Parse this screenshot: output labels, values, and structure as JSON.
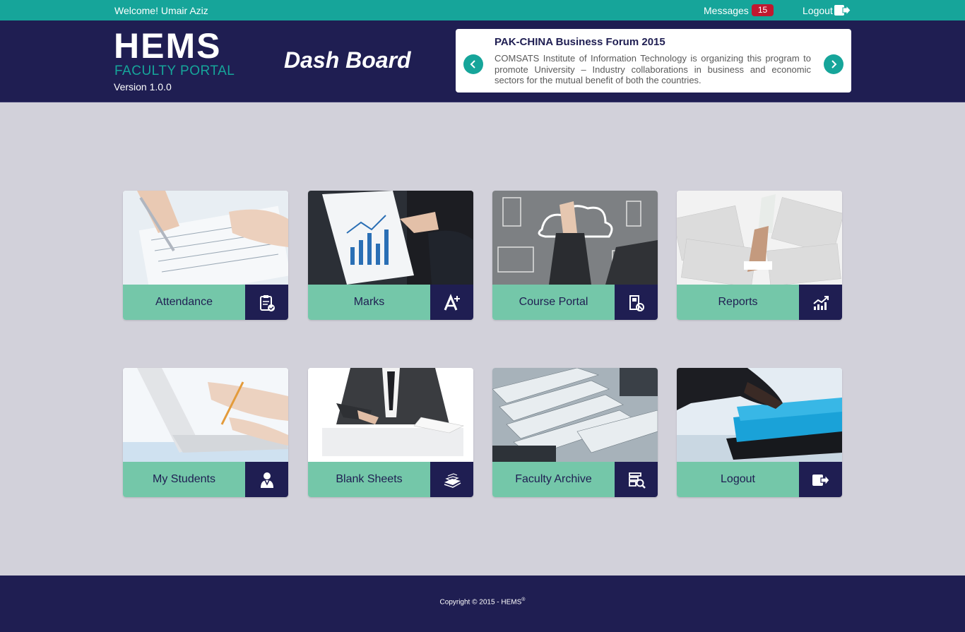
{
  "topbar": {
    "welcome": "Welcome! Umair Aziz",
    "messages_label": "Messages",
    "messages_count": "15",
    "logout_label": "Logout"
  },
  "header": {
    "logo_title": "HEMS",
    "logo_subtitle": "FACULTY PORTAL",
    "version": "Version 1.0.0",
    "page_title": "Dash Board"
  },
  "news": {
    "title": "PAK-CHINA Business Forum 2015",
    "body": "COMSATS Institute of Information Technology is organizing this program to promote University – Industry collaborations in business and economic sectors for the mutual benefit of both the countries."
  },
  "tiles": [
    {
      "label": "Attendance",
      "icon": "clipboard-check-icon"
    },
    {
      "label": "Marks",
      "icon": "grade-a-plus-icon"
    },
    {
      "label": "Course Portal",
      "icon": "course-book-icon"
    },
    {
      "label": "Reports",
      "icon": "trend-chart-icon"
    },
    {
      "label": "My Students",
      "icon": "student-icon"
    },
    {
      "label": "Blank Sheets",
      "icon": "paper-stack-icon"
    },
    {
      "label": "Faculty Archive",
      "icon": "archive-search-icon"
    },
    {
      "label": "Logout",
      "icon": "logout-icon"
    }
  ],
  "footer": {
    "copyright": "Copyright © 2015 - HEMS",
    "registered": "®"
  },
  "colors": {
    "teal": "#16a59a",
    "navy": "#1f1e52",
    "mint": "#74c7a9",
    "badge_red": "#c0182f",
    "background": "#d2d1da"
  }
}
